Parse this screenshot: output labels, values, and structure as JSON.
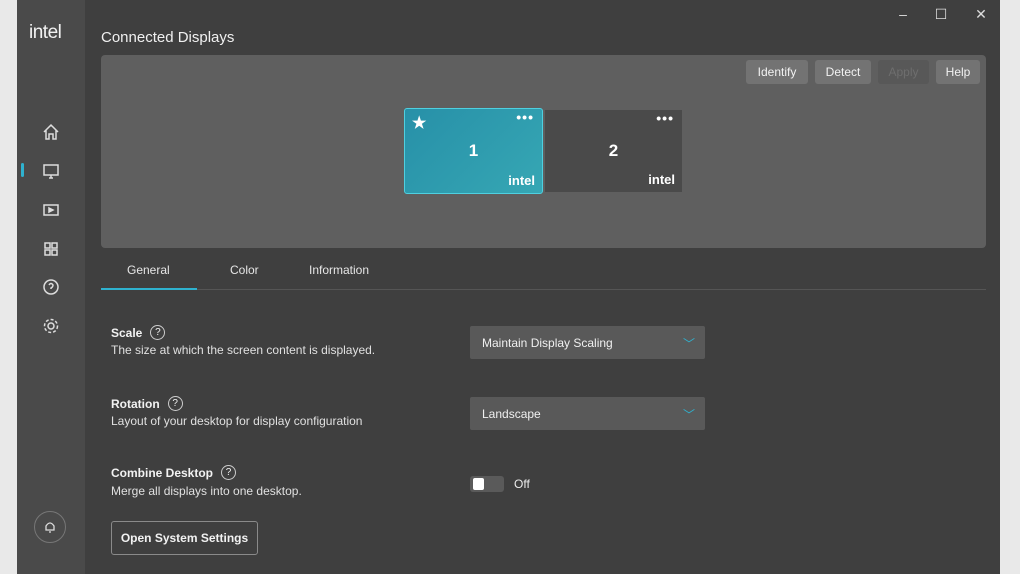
{
  "app": {
    "logo": "intel",
    "title": "Connected Displays"
  },
  "window_controls": {
    "minimize": "–",
    "maximize": "☐",
    "close": "✕"
  },
  "sidebar": {
    "items": [
      {
        "icon": "home-icon"
      },
      {
        "icon": "display-icon",
        "active": true
      },
      {
        "icon": "video-icon"
      },
      {
        "icon": "apps-icon"
      },
      {
        "icon": "help-icon"
      },
      {
        "icon": "gear-icon"
      }
    ],
    "bell": "bell-icon"
  },
  "toolbar": {
    "identify": "Identify",
    "detect": "Detect",
    "apply": "Apply",
    "help": "Help"
  },
  "displays": [
    {
      "number": "1",
      "brand": "intel",
      "primary": true,
      "selected": true
    },
    {
      "number": "2",
      "brand": "intel",
      "primary": false,
      "selected": false
    }
  ],
  "tabs": [
    {
      "label": "General",
      "active": true
    },
    {
      "label": "Color"
    },
    {
      "label": "Information"
    }
  ],
  "settings": {
    "scale": {
      "label": "Scale",
      "desc": "The size at which the screen content is displayed.",
      "value": "Maintain Display Scaling"
    },
    "rotation": {
      "label": "Rotation",
      "desc": "Layout of your desktop for display configuration",
      "value": "Landscape"
    },
    "combine": {
      "label": "Combine Desktop",
      "desc": "Merge all displays into one desktop.",
      "state": "Off"
    },
    "open_settings": "Open System Settings"
  },
  "colors": {
    "accent": "#2fb2cf",
    "primary_display": "#2a9cb0"
  }
}
